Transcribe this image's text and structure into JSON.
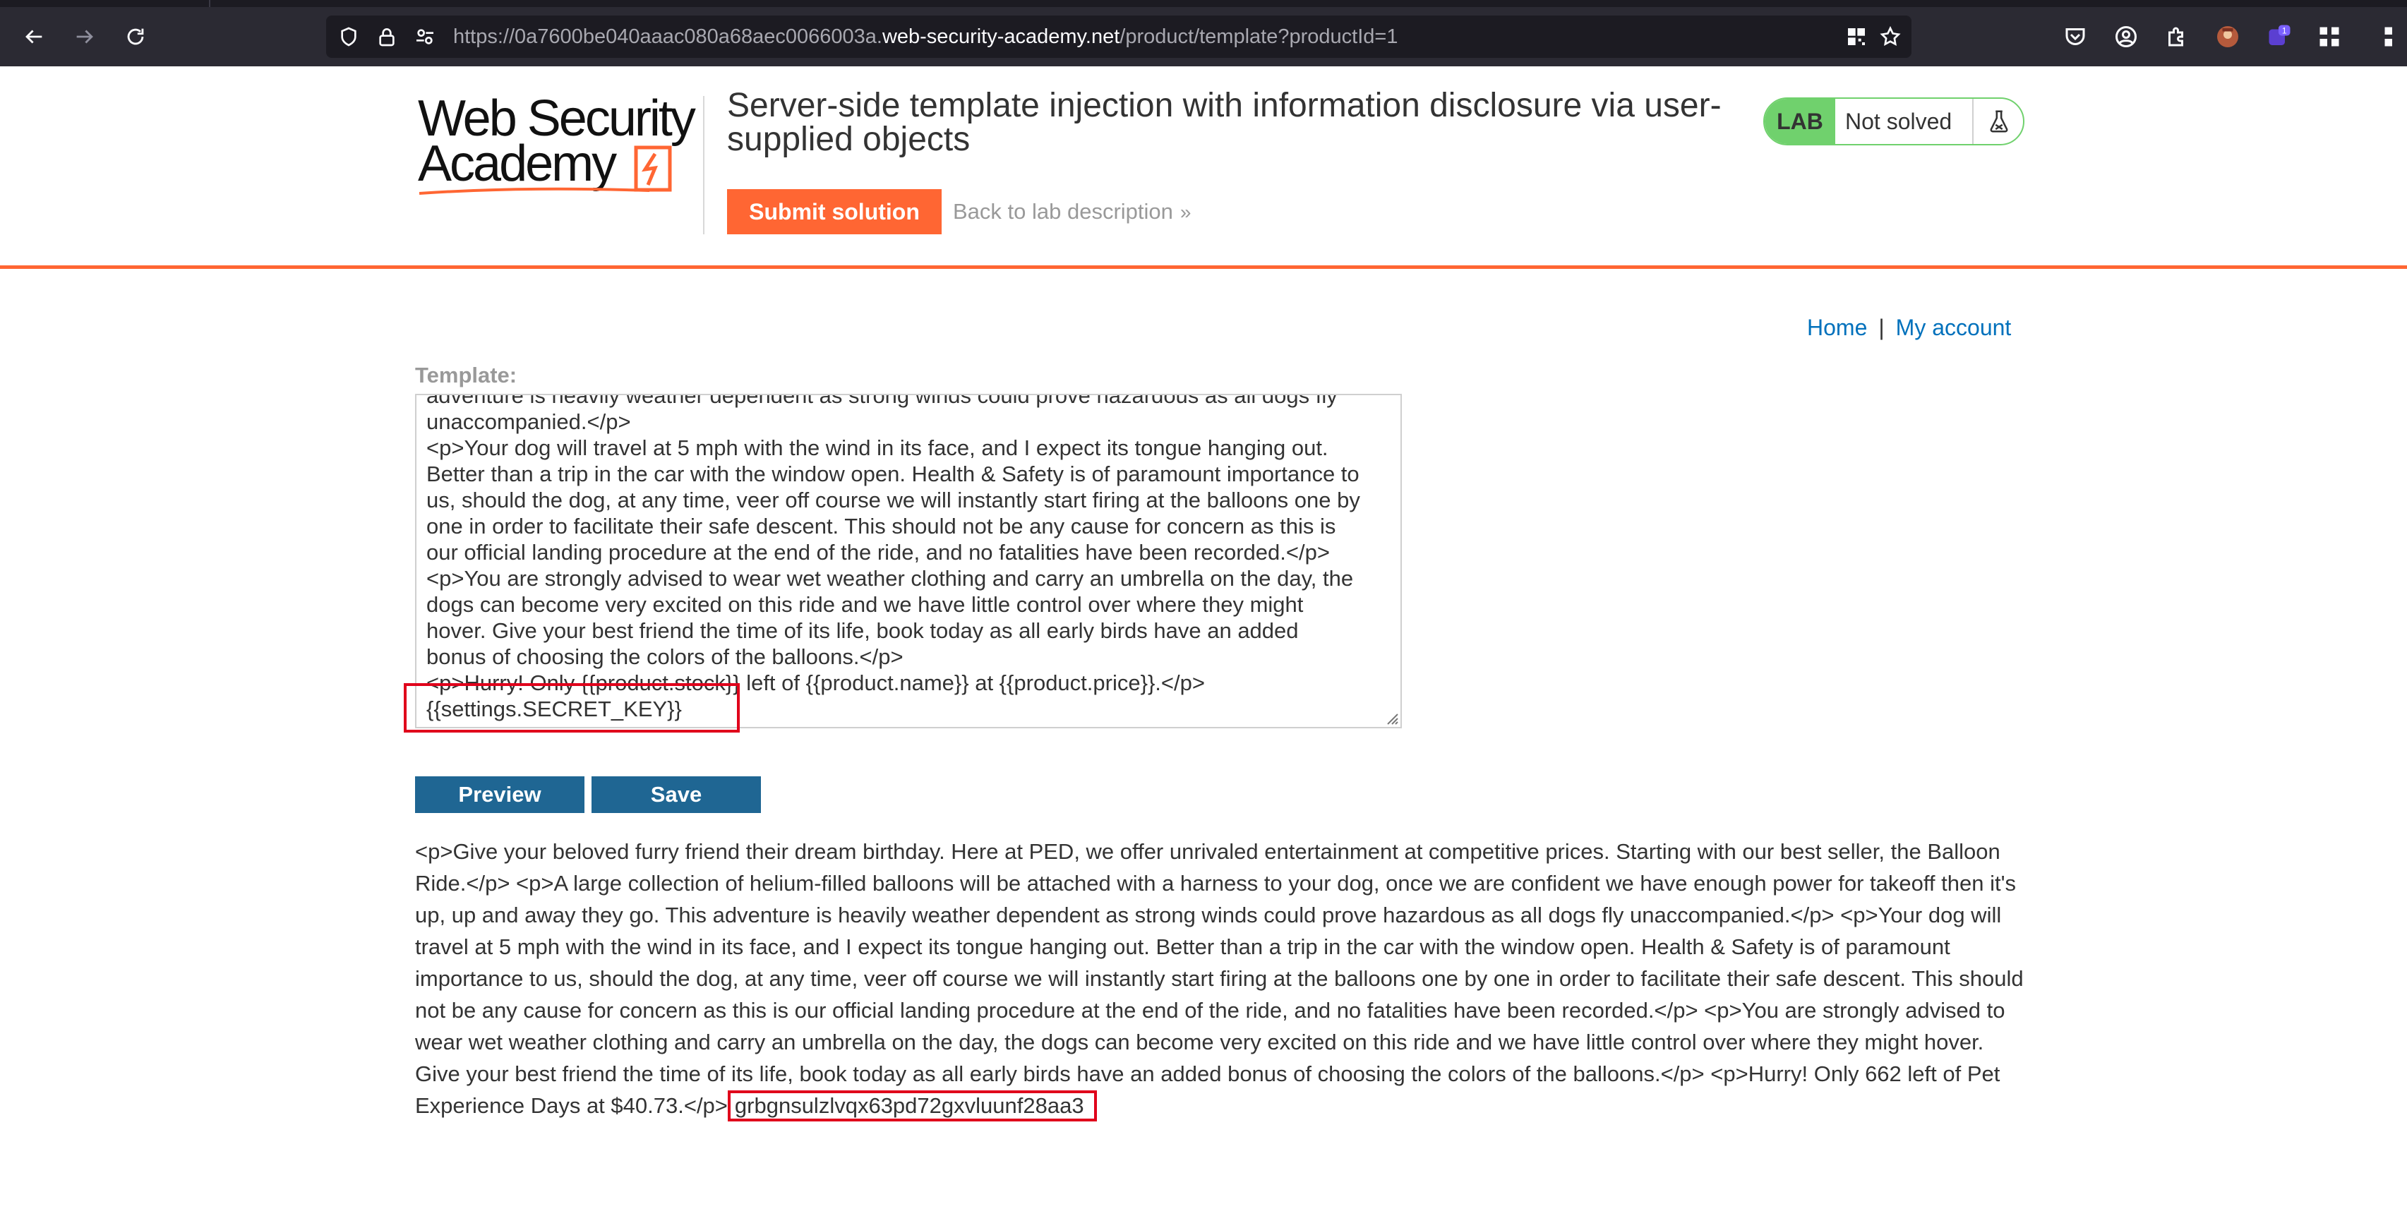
{
  "browser": {
    "url_prefix": "https://0a7600be040aaac080a68aec0066003a.",
    "url_domain": "web-security-academy.net",
    "url_path": "/product/template?productId=1",
    "extension_badge": "1"
  },
  "header": {
    "logo_line1": "Web Security",
    "logo_line2": "Academy",
    "lab_title": "Server-side template injection with information disclosure via user-supplied objects",
    "submit_label": "Submit solution",
    "back_label": "Back to lab description",
    "lab_badge": "LAB",
    "lab_status": "Not solved",
    "accent_color": "#ff6633",
    "status_color": "#70d16d"
  },
  "nav": {
    "home": "Home",
    "separator": "|",
    "account": "My account"
  },
  "editor": {
    "label": "Template:",
    "lines": [
      "adventure is heavily weather dependent as strong winds could prove hazardous as all dogs fly",
      "unaccompanied.</p>",
      "<p>Your dog will travel at 5 mph with the wind in its face, and I expect its tongue hanging out.",
      "Better than a trip in the car with the window open. Health & Safety is of paramount importance to",
      "us, should the dog, at any time, veer off course we will instantly start firing at the balloons one by",
      "one in order to facilitate their safe descent. This should not be any cause for concern as this is",
      "our official landing procedure at the end of the ride, and no fatalities have been recorded.</p>",
      "<p>You are strongly advised to wear wet weather clothing and carry an umbrella on the day, the",
      "dogs can become very excited on this ride and we have little control over where they might",
      "hover. Give your best friend the time of its life, book today as all early birds have an added",
      "bonus of choosing the colors of the balloons.</p>",
      "<p>Hurry! Only {{product.stock}} left of {{product.name}} at {{product.price}}.</p>",
      "{{settings.SECRET_KEY}}"
    ]
  },
  "buttons": {
    "preview": "Preview",
    "save": "Save"
  },
  "preview": {
    "text": "<p>Give your beloved furry friend their dream birthday. Here at PED, we offer unrivaled entertainment at competitive prices. Starting with our best seller, the Balloon Ride.</p> <p>A large collection of helium-filled balloons will be attached with a harness to your dog, once we are confident we have enough power for takeoff then it's up, up and away they go. This adventure is heavily weather dependent as strong winds could prove hazardous as all dogs fly unaccompanied.</p> <p>Your dog will travel at 5 mph with the wind in its face, and I expect its tongue hanging out. Better than a trip in the car with the window open. Health & Safety is of paramount importance to us, should the dog, at any time, veer off course we will instantly start firing at the balloons one by one in order to facilitate their safe descent. This should not be any cause for concern as this is our official landing procedure at the end of the ride, and no fatalities have been recorded.</p> <p>You are strongly advised to wear wet weather clothing and carry an umbrella on the day, the dogs can become very excited on this ride and we have little control over where they might hover. Give your best friend the time of its life, book today as all early birds have an added bonus of choosing the colors of the balloons.</p> <p>Hurry! Only 662 left of Pet Experience Days at $40.73.</p>",
    "secret_key": "grbgnsulzlvqx63pd72gxvluunf28aa3"
  }
}
